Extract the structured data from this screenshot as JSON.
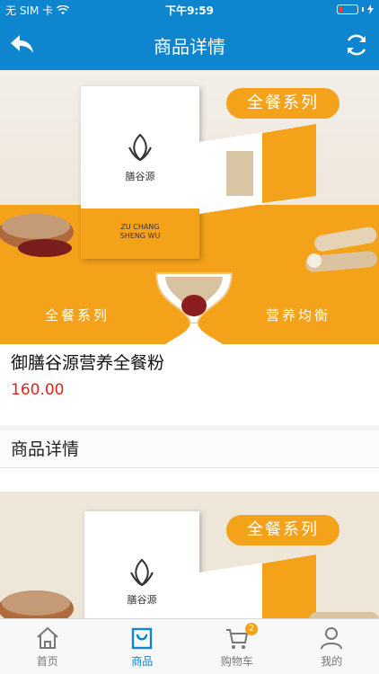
{
  "status_bar": {
    "carrier": "无 SIM 卡",
    "time": "下午9:59"
  },
  "nav": {
    "title": "商品详情",
    "back_icon": "back-arrow-icon",
    "refresh_icon": "refresh-icon"
  },
  "banner": {
    "badge_text": "全餐系列",
    "caption_left": "全餐系列",
    "caption_right": "营养均衡",
    "box_brand": "膳谷源",
    "box_subtitle_line1": "ZU CHANG",
    "box_subtitle_line2": "SHENG WU"
  },
  "product": {
    "name": "御膳谷源营养全餐粉",
    "price": "160.00"
  },
  "details": {
    "section_title": "商品详情",
    "badge_text": "全餐系列",
    "box_brand": "膳谷源"
  },
  "tab_bar": {
    "items": [
      {
        "label": "首页",
        "icon": "home-icon"
      },
      {
        "label": "商品",
        "icon": "shopping-bag-icon"
      },
      {
        "label": "购物车",
        "icon": "cart-icon"
      },
      {
        "label": "我的",
        "icon": "user-icon"
      }
    ],
    "cart_badge": "2",
    "active_index": 1
  },
  "colors": {
    "primary": "#0d86cf",
    "accent": "#f5a21b",
    "price": "#e2231a"
  }
}
